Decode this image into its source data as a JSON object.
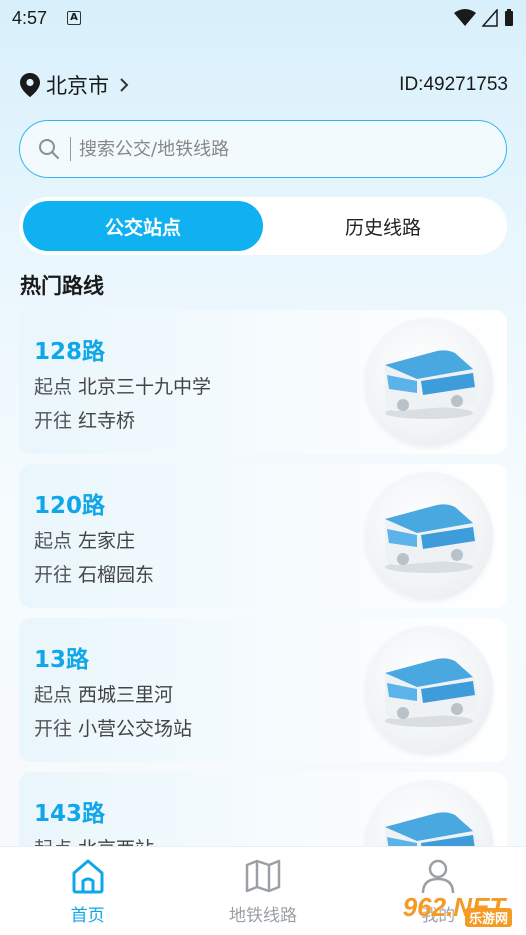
{
  "status_bar": {
    "time": "4:57",
    "notif_glyph": "A"
  },
  "header": {
    "city": "北京市",
    "user_id": "ID:49271753"
  },
  "search": {
    "placeholder": "搜索公交/地铁线路"
  },
  "tabs": [
    {
      "label": "公交站点",
      "active": true
    },
    {
      "label": "历史线路",
      "active": false
    }
  ],
  "section_title": "热门路线",
  "routes": [
    {
      "name": "128路",
      "from_label": "起点",
      "from": "北京三十九中学",
      "to_label": "开往",
      "to": "红寺桥"
    },
    {
      "name": "120路",
      "from_label": "起点",
      "from": "左家庄",
      "to_label": "开往",
      "to": "石榴园东"
    },
    {
      "name": "13路",
      "from_label": "起点",
      "from": "西城三里河",
      "to_label": "开往",
      "to": "小营公交场站"
    },
    {
      "name": "143路",
      "from_label": "起点",
      "from": "北京西站",
      "to_label": "",
      "to": ""
    }
  ],
  "bottom_nav": [
    {
      "label": "首页",
      "icon": "home-icon",
      "active": true
    },
    {
      "label": "地铁线路",
      "icon": "map-icon",
      "active": false
    },
    {
      "label": "我的",
      "icon": "user-icon",
      "active": false
    }
  ],
  "watermark": {
    "big": "962.NET",
    "small": "乐游网"
  },
  "colors": {
    "accent": "#10b1f1",
    "route_name": "#10a7e9",
    "search_border": "#35b7ee"
  }
}
